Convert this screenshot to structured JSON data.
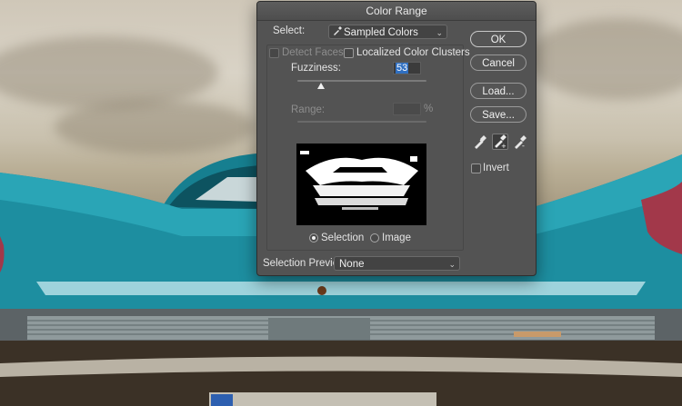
{
  "dialog": {
    "title": "Color Range",
    "select_label": "Select:",
    "select_value": "Sampled Colors",
    "detect_faces_label": "Detect Faces",
    "localized_label": "Localized Color Clusters",
    "fuzziness_label": "Fuzziness:",
    "fuzziness_value": "53",
    "range_label": "Range:",
    "range_unit": "%",
    "selection_radio": "Selection",
    "image_radio": "Image",
    "preview_label": "Selection Preview:",
    "preview_value": "None",
    "invert_label": "Invert",
    "fuzziness_fraction": 0.18
  },
  "buttons": {
    "ok": "OK",
    "cancel": "Cancel",
    "load": "Load...",
    "save": "Save..."
  },
  "icons": [
    "eyedropper-icon",
    "eyedropper-plus-icon",
    "eyedropper-minus-icon",
    "chevron-down-icon"
  ]
}
